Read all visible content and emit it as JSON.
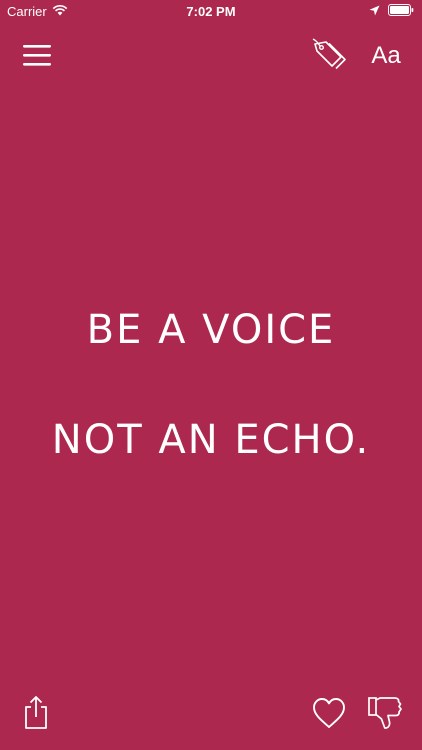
{
  "status_bar": {
    "carrier": "Carrier",
    "time": "7:02 PM",
    "icons": [
      "wifi-icon",
      "location-arrow-icon",
      "battery-icon"
    ]
  },
  "toolbar": {
    "menu_icon": "hamburger-menu-icon",
    "tags_icon": "tags-icon",
    "font_label": "Aa"
  },
  "quote": {
    "line1": "Be a voice",
    "line2": "not an echo."
  },
  "bottom_bar": {
    "share_icon": "share-icon",
    "favorite_icon": "heart-icon",
    "dislike_icon": "thumbs-down-icon"
  },
  "colors": {
    "background": "#AD284E",
    "foreground": "#FFFFFF"
  }
}
